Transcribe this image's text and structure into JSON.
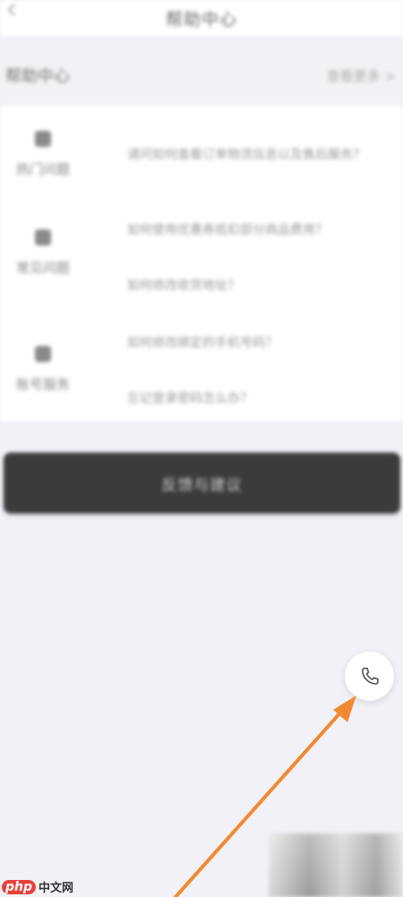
{
  "header": {
    "title": "帮助中心"
  },
  "section": {
    "title": "帮助中心",
    "link": "查看更多 >"
  },
  "faq": [
    {
      "category": "热门问题",
      "questions": [
        "请问如何查看订单物流信息以及售后服务？"
      ]
    },
    {
      "category": "常见问题",
      "questions": [
        "如何使用优惠券抵扣部分商品费用？",
        "如何修改收货地址？"
      ]
    },
    {
      "category": "账号服务",
      "questions": [
        "如何修改绑定的手机号码？",
        "忘记登录密码怎么办？"
      ]
    }
  ],
  "main_button": {
    "label": "反馈与建议"
  },
  "call_button": {
    "icon": "phone-icon"
  },
  "watermark": {
    "logo": "php",
    "text": "中文网"
  },
  "colors": {
    "background": "#f1f1f7",
    "button": "#3b3b3b",
    "arrow": "#f08a32",
    "watermark_red": "#e8413b"
  }
}
